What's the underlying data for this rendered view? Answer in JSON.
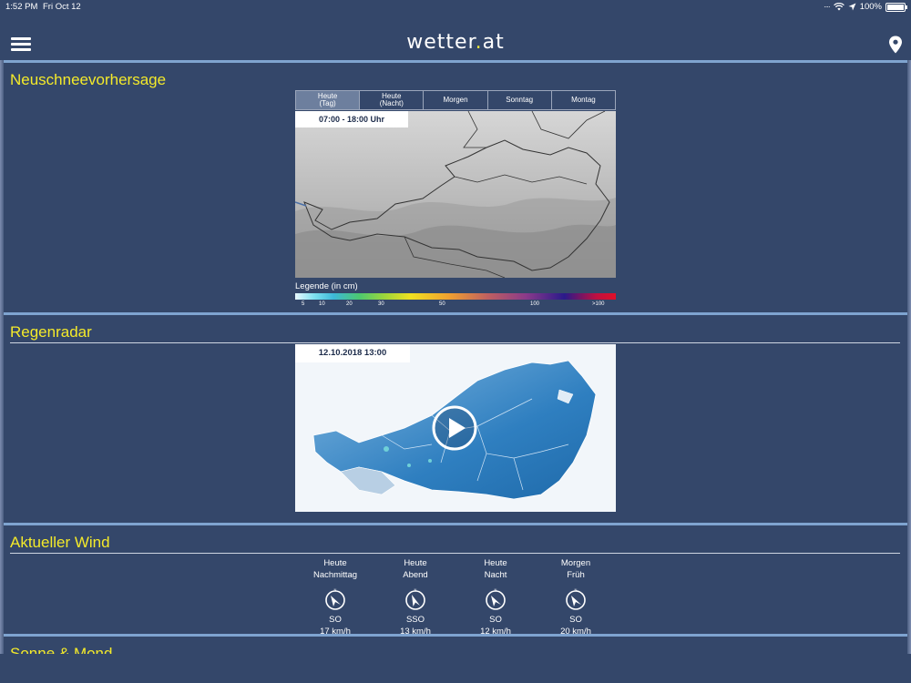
{
  "statusbar": {
    "time": "1:52 PM",
    "date": "Fri Oct 12",
    "battery": "100%",
    "icons": [
      "signal-dots-icon",
      "wifi-icon",
      "location-arrow-icon",
      "battery-icon"
    ]
  },
  "header": {
    "logo_main": "wetter",
    "logo_dot": ".",
    "logo_tld": "at",
    "menu_icon": "hamburger-menu-icon",
    "location_icon": "location-pin-icon"
  },
  "snow_forecast": {
    "title": "Neuschneevorhersage",
    "tabs": [
      {
        "line1": "Heute",
        "line2": "(Tag)",
        "active": true
      },
      {
        "line1": "Heute",
        "line2": "(Nacht)",
        "active": false
      },
      {
        "line1": "Morgen",
        "line2": "",
        "active": false
      },
      {
        "line1": "Sonntag",
        "line2": "",
        "active": false
      },
      {
        "line1": "Montag",
        "line2": "",
        "active": false
      }
    ],
    "time_range": "07:00 - 18:00 Uhr",
    "legend_title": "Legende (in cm)",
    "legend_ticks": [
      "5",
      "10",
      "20",
      "30",
      "50",
      "100",
      ">100"
    ]
  },
  "rain_radar": {
    "title": "Regenradar",
    "timestamp": "12.10.2018 13:00",
    "play_icon": "play-icon"
  },
  "wind": {
    "title": "Aktueller Wind",
    "columns": [
      {
        "line1": "Heute",
        "line2": "Nachmittag",
        "direction": "SO",
        "speed": "17 km/h"
      },
      {
        "line1": "Heute",
        "line2": "Abend",
        "direction": "SSO",
        "speed": "13 km/h"
      },
      {
        "line1": "Heute",
        "line2": "Nacht",
        "direction": "SO",
        "speed": "12 km/h"
      },
      {
        "line1": "Morgen",
        "line2": "Früh",
        "direction": "SO",
        "speed": "20 km/h"
      }
    ]
  },
  "sun_moon": {
    "title": "Sonne & Mond"
  },
  "colors": {
    "background": "#34476a",
    "title_yellow": "#f4ea2a",
    "section_border": "#7fa4d0",
    "radar_blue": "#2f7fc0"
  }
}
